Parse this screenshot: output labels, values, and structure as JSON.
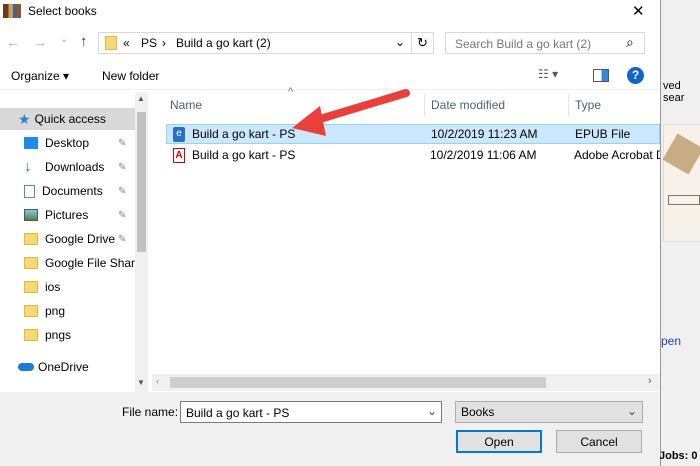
{
  "window": {
    "title": "Select books",
    "close": "✕"
  },
  "nav": {
    "back": "←",
    "forward": "→",
    "recent": "⌄",
    "up": "↑",
    "crumb_sep": "«",
    "path": [
      "PS",
      "Build a go kart (2)"
    ],
    "sep": "›",
    "dropdown": "⌄",
    "refresh": "↻",
    "search_placeholder": "Search Build a go kart (2)",
    "search_icon": "⌕"
  },
  "toolbar": {
    "organize": "Organize ▾",
    "new_folder": "New folder",
    "view": "☷ ▾",
    "help": "?"
  },
  "sidebar": {
    "items": [
      {
        "label": "Quick access",
        "icon": "star"
      },
      {
        "label": "Desktop",
        "icon": "desktop",
        "pinned": true
      },
      {
        "label": "Downloads",
        "icon": "download",
        "pinned": true
      },
      {
        "label": "Documents",
        "icon": "documents",
        "pinned": true
      },
      {
        "label": "Pictures",
        "icon": "pictures",
        "pinned": true
      },
      {
        "label": "Google Drive",
        "icon": "folder",
        "pinned": true
      },
      {
        "label": "Google File Shar",
        "icon": "folder"
      },
      {
        "label": "ios",
        "icon": "folder"
      },
      {
        "label": "png",
        "icon": "folder"
      },
      {
        "label": "pngs",
        "icon": "folder"
      },
      {
        "label": "OneDrive",
        "icon": "cloud"
      }
    ],
    "pin": "📌"
  },
  "columns": [
    "Name",
    "Date modified",
    "Type"
  ],
  "files": [
    {
      "name": "Build a go kart - PS",
      "date": "10/2/2019 11:23 AM",
      "type": "EPUB File",
      "selected": true
    },
    {
      "name": "Build a go kart - PS",
      "date": "10/2/2019 11:06 AM",
      "type": "Adobe Acrobat D"
    }
  ],
  "bottom": {
    "file_name_label": "File name:",
    "file_name_value": "Build a go kart - PS",
    "filter": "Books",
    "open": "Open",
    "cancel": "Cancel"
  },
  "background": {
    "text1": "ved sear",
    "text2": "pen",
    "text3": "Jobs: 0"
  }
}
